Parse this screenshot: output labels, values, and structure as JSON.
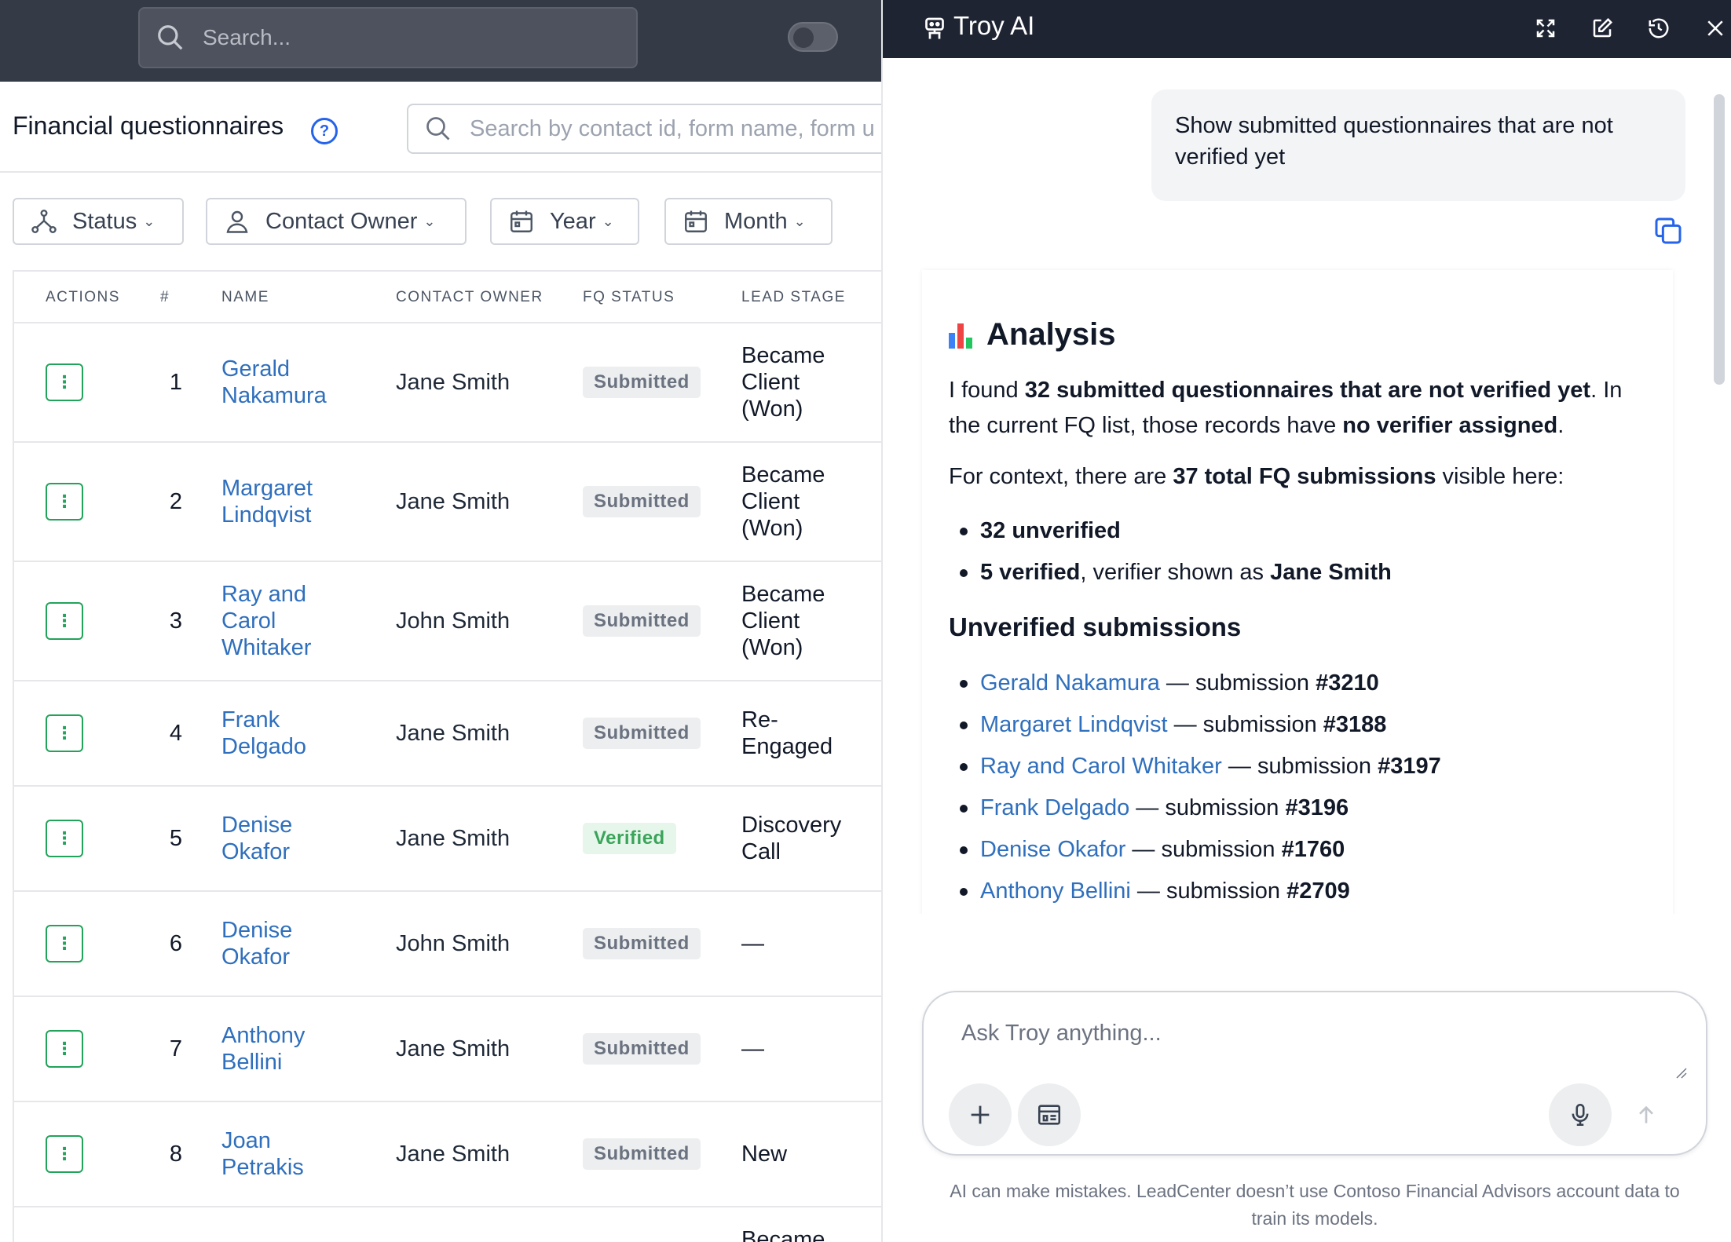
{
  "topbar": {
    "search_placeholder": "Search..."
  },
  "page": {
    "title": "Financial questionnaires",
    "search_placeholder": "Search by contact id, form name, form u",
    "filters": {
      "status": "Status",
      "contact_owner": "Contact Owner",
      "year": "Year",
      "month": "Month"
    }
  },
  "table": {
    "headers": {
      "actions": "ACTIONS",
      "num": "#",
      "name": "NAME",
      "owner": "CONTACT OWNER",
      "fq_status": "FQ STATUS",
      "lead_stage": "LEAD STAGE"
    },
    "rows": [
      {
        "num": "1",
        "name": "Gerald Nakamura",
        "owner": "Jane Smith",
        "status": "Submitted",
        "stage": "Became Client (Won)"
      },
      {
        "num": "2",
        "name": "Margaret Lindqvist",
        "owner": "Jane Smith",
        "status": "Submitted",
        "stage": "Became Client (Won)"
      },
      {
        "num": "3",
        "name": "Ray and Carol Whitaker",
        "owner": "John Smith",
        "status": "Submitted",
        "stage": "Became Client (Won)"
      },
      {
        "num": "4",
        "name": "Frank Delgado",
        "owner": "Jane Smith",
        "status": "Submitted",
        "stage": "Re-Engaged"
      },
      {
        "num": "5",
        "name": "Denise Okafor",
        "owner": "Jane Smith",
        "status": "Verified",
        "stage": "Discovery Call"
      },
      {
        "num": "6",
        "name": "Denise Okafor",
        "owner": "John Smith",
        "status": "Submitted",
        "stage": "—"
      },
      {
        "num": "7",
        "name": "Anthony Bellini",
        "owner": "Jane Smith",
        "status": "Submitted",
        "stage": "—"
      },
      {
        "num": "8",
        "name": "Joan Petrakis",
        "owner": "Jane Smith",
        "status": "Submitted",
        "stage": "New"
      },
      {
        "num": "",
        "name": "",
        "owner": "",
        "status": "",
        "stage": "Became"
      }
    ]
  },
  "assistant": {
    "title": "Troy AI",
    "user_message": "Show submitted questionnaires that are not verified yet",
    "analysis": {
      "heading": "Analysis",
      "p1_a": "I found ",
      "p1_b": "32 submitted questionnaires that are not verified yet",
      "p1_c": ". In the current FQ list, those records have ",
      "p1_d": "no verifier assigned",
      "p1_e": ".",
      "p2_a": "For context, there are ",
      "p2_b": "37 total FQ submissions",
      "p2_c": " visible here:",
      "bullet1": "32 unverified",
      "bullet2_a": "5 verified",
      "bullet2_b": ", verifier shown as ",
      "bullet2_c": "Jane Smith",
      "subheading": "Unverified submissions",
      "submission_label": " — submission ",
      "submissions": [
        {
          "name": "Gerald Nakamura",
          "id": "#3210"
        },
        {
          "name": "Margaret Lindqvist",
          "id": "#3188"
        },
        {
          "name": "Ray and Carol Whitaker",
          "id": "#3197"
        },
        {
          "name": "Frank Delgado",
          "id": "#3196"
        },
        {
          "name": "Denise Okafor",
          "id": "#1760"
        },
        {
          "name": "Anthony Bellini",
          "id": "#2709"
        }
      ]
    },
    "composer_placeholder": "Ask Troy anything...",
    "disclaimer": "AI can make mistakes. LeadCenter doesn’t use Contoso Financial Advisors account data to train its models."
  },
  "colors": {
    "link": "#2f6fbd",
    "action_green": "#22a35a",
    "verified_green": "#3aa45a",
    "topbar": "#343a46",
    "panel_header": "#1f2433"
  }
}
